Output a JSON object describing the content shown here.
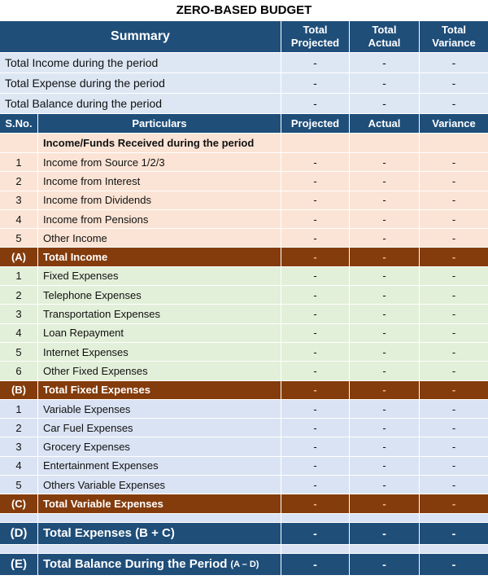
{
  "title": "ZERO-BASED BUDGET",
  "header": {
    "summary": "Summary",
    "total_projected_line1": "Total",
    "total_projected_line2": "Projected",
    "total_actual_line1": "Total",
    "total_actual_line2": "Actual",
    "total_variance_line1": "Total",
    "total_variance_line2": "Variance"
  },
  "summary_rows": [
    {
      "label": "Total Income during the period",
      "projected": "-",
      "actual": "-",
      "variance": "-"
    },
    {
      "label": "Total Expense during the period",
      "projected": "-",
      "actual": "-",
      "variance": "-"
    },
    {
      "label": "Total Balance during the period",
      "projected": "-",
      "actual": "-",
      "variance": "-"
    }
  ],
  "columns": {
    "sno": "S.No.",
    "particulars": "Particulars",
    "projected": "Projected",
    "actual": "Actual",
    "variance": "Variance"
  },
  "income": {
    "heading": "Income/Funds Received during the period",
    "rows": [
      {
        "sno": "1",
        "label": "Income from Source 1/2/3",
        "projected": "-",
        "actual": "-",
        "variance": "-"
      },
      {
        "sno": "2",
        "label": "Income from Interest",
        "projected": "-",
        "actual": "-",
        "variance": "-"
      },
      {
        "sno": "3",
        "label": "Income from Dividends",
        "projected": "-",
        "actual": "-",
        "variance": "-"
      },
      {
        "sno": "4",
        "label": "Income from Pensions",
        "projected": "-",
        "actual": "-",
        "variance": "-"
      },
      {
        "sno": "5",
        "label": "Other Income",
        "projected": "-",
        "actual": "-",
        "variance": "-"
      }
    ],
    "total": {
      "sno": "(A)",
      "label": "Total Income",
      "projected": "-",
      "actual": "-",
      "variance": "-"
    }
  },
  "fixed": {
    "rows": [
      {
        "sno": "1",
        "label": "Fixed Expenses",
        "projected": "-",
        "actual": "-",
        "variance": "-"
      },
      {
        "sno": "2",
        "label": "Telephone Expenses",
        "projected": "-",
        "actual": "-",
        "variance": "-"
      },
      {
        "sno": "3",
        "label": "Transportation Expenses",
        "projected": "-",
        "actual": "-",
        "variance": "-"
      },
      {
        "sno": "4",
        "label": "Loan Repayment",
        "projected": "-",
        "actual": "-",
        "variance": "-"
      },
      {
        "sno": "5",
        "label": "Internet Expenses",
        "projected": "-",
        "actual": "-",
        "variance": "-"
      },
      {
        "sno": "6",
        "label": "Other Fixed Expenses",
        "projected": "-",
        "actual": "-",
        "variance": "-"
      }
    ],
    "total": {
      "sno": "(B)",
      "label": "Total Fixed Expenses",
      "projected": "-",
      "actual": "-",
      "variance": "-"
    }
  },
  "variable": {
    "rows": [
      {
        "sno": "1",
        "label": "Variable Expenses",
        "projected": "-",
        "actual": "-",
        "variance": "-"
      },
      {
        "sno": "2",
        "label": "Car Fuel Expenses",
        "projected": "-",
        "actual": "-",
        "variance": "-"
      },
      {
        "sno": "3",
        "label": "Grocery Expenses",
        "projected": "-",
        "actual": "-",
        "variance": "-"
      },
      {
        "sno": "4",
        "label": "Entertainment Expenses",
        "projected": "-",
        "actual": "-",
        "variance": "-"
      },
      {
        "sno": "5",
        "label": "Others Variable Expenses",
        "projected": "-",
        "actual": "-",
        "variance": "-"
      }
    ],
    "total": {
      "sno": "(C)",
      "label": "Total Variable Expenses",
      "projected": "-",
      "actual": "-",
      "variance": "-"
    }
  },
  "grand": [
    {
      "sno": "(D)",
      "label": "Total Expenses (B + C)",
      "suffix": "",
      "projected": "-",
      "actual": "-",
      "variance": "-"
    },
    {
      "sno": "(E)",
      "label": "Total Balance During the Period",
      "suffix": "(A – D)",
      "projected": "-",
      "actual": "-",
      "variance": "-"
    }
  ],
  "colors": {
    "header_blue": "#1f4e79",
    "total_brown": "#843c0c",
    "income_peach": "#fbe4d5",
    "fixed_green": "#e2efd9",
    "variable_blue": "#dae3f3",
    "summary_blue": "#dde7f4"
  }
}
